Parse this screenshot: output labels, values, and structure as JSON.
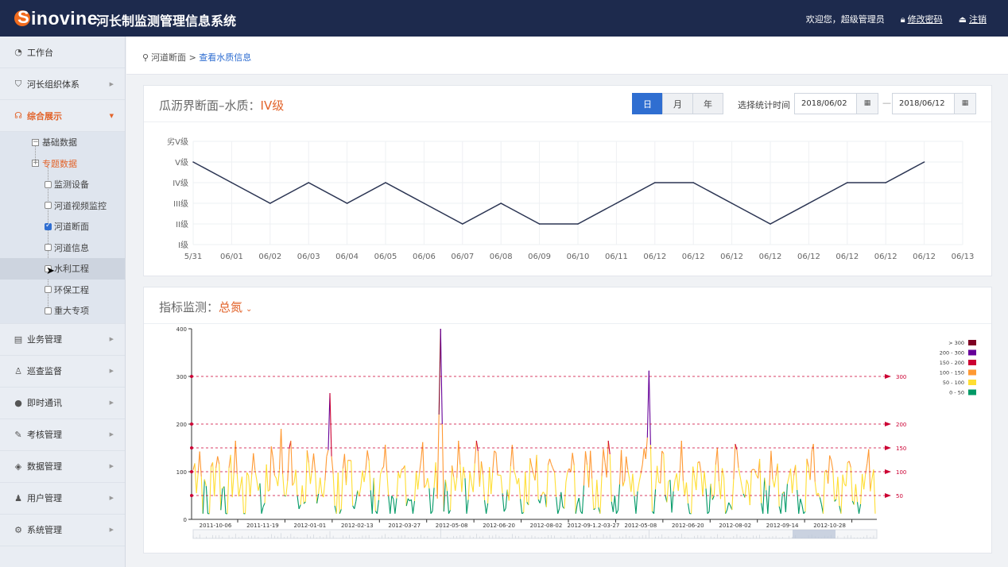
{
  "header": {
    "logo_text": "inovine",
    "logo_letter": "S",
    "system_title": "河长制监测管理信息系统",
    "welcome": "欢迎您，超级管理员",
    "change_password": "修改密码",
    "logout": "注销"
  },
  "sidebar": {
    "items": [
      {
        "label": "工作台",
        "icon": "dashboard-icon"
      },
      {
        "label": "河长组织体系",
        "icon": "org-icon"
      },
      {
        "label": "综合展示",
        "icon": "display-icon"
      },
      {
        "label": "业务管理",
        "icon": "business-icon"
      },
      {
        "label": "巡查监督",
        "icon": "patrol-icon"
      },
      {
        "label": "即时通讯",
        "icon": "chat-icon"
      },
      {
        "label": "考核管理",
        "icon": "assess-icon"
      },
      {
        "label": "数据管理",
        "icon": "data-icon"
      },
      {
        "label": "用户管理",
        "icon": "user-icon"
      },
      {
        "label": "系统管理",
        "icon": "settings-icon"
      }
    ],
    "tree": {
      "basic": "基础数据",
      "topic": "专题数据",
      "children": [
        "监测设备",
        "河道视频监控",
        "河道断面",
        "河道信息",
        "水利工程",
        "环保工程",
        "重大专项"
      ],
      "checked_index": 2
    }
  },
  "breadcrumb": {
    "parent": "河道断面",
    "separator": ">",
    "current": "查看水质信息"
  },
  "water_panel": {
    "title_prefix": "瓜沥界断面–水质：",
    "title_level": "IV级",
    "seg_day": "日",
    "seg_month": "月",
    "seg_year": "年",
    "time_label": "选择统计时间",
    "date_from": "2018/06/02",
    "date_to": "2018/06/12",
    "range_dash": "—"
  },
  "index_panel": {
    "title_prefix": "指标监测：",
    "indicator": "总氮"
  },
  "chart_data": [
    {
      "type": "line",
      "y_categories": [
        "I级",
        "II级",
        "III级",
        "IV级",
        "V级",
        "劣V级"
      ],
      "x": [
        "5/31",
        "06/01",
        "06/02",
        "06/03",
        "06/04",
        "06/05",
        "06/06",
        "06/07",
        "06/08",
        "06/09",
        "06/10",
        "06/11",
        "06/12",
        "06/12",
        "06/12",
        "06/12",
        "06/12",
        "06/12",
        "06/12",
        "06/12",
        "06/13"
      ],
      "values": [
        5,
        4,
        3,
        4,
        3,
        4,
        3,
        2,
        3,
        2,
        2,
        3,
        4,
        4,
        3,
        2,
        3,
        4,
        4,
        5
      ],
      "color": "#2b3553",
      "grid": true
    },
    {
      "type": "line",
      "ylim": [
        0,
        400
      ],
      "y_ticks": [
        0,
        100,
        200,
        300,
        400
      ],
      "x_ticks": [
        "2011-10-06",
        "2011-11-19",
        "2012-01-01",
        "2012-02-13",
        "2012-03-27",
        "2012-05-08",
        "2012-06-20",
        "2012-08-02",
        "2012-09-1.2-03-27",
        "2012-05-08",
        "2012-06-20",
        "2012-08-02",
        "2012-09-14",
        "2012-10-28"
      ],
      "mark_lines": [
        {
          "value": 300,
          "label": "300"
        },
        {
          "value": 200,
          "label": "200"
        },
        {
          "value": 150,
          "label": "150"
        },
        {
          "value": 100,
          "label": "100"
        },
        {
          "value": 50,
          "label": "50"
        }
      ],
      "legend": [
        {
          "label": "> 300",
          "color": "#7e0023"
        },
        {
          "label": "200 - 300",
          "color": "#660099"
        },
        {
          "label": "150 - 200",
          "color": "#cc0033"
        },
        {
          "label": "100 - 150",
          "color": "#ff9933"
        },
        {
          "label": "50 - 100",
          "color": "#ffde33"
        },
        {
          "label": "0 - 50",
          "color": "#096"
        }
      ],
      "legend_position": "top-right",
      "mark_line_color": "#cc0033",
      "spikes": [
        {
          "x_fraction": 0.13,
          "value": 190
        },
        {
          "x_fraction": 0.2,
          "value": 265
        },
        {
          "x_fraction": 0.363,
          "value": 400
        },
        {
          "x_fraction": 0.668,
          "value": 312
        }
      ],
      "value_range_note": "Dense daily series, base mostly 20–160"
    }
  ]
}
